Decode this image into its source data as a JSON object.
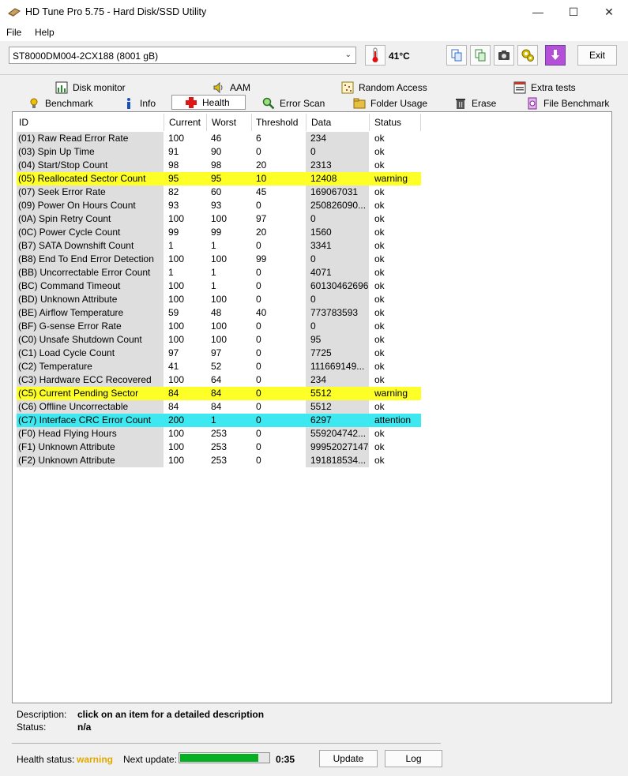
{
  "window": {
    "title": "HD Tune Pro 5.75 - Hard Disk/SSD Utility",
    "minimize_glyph": "—",
    "maximize_glyph": "☐",
    "close_glyph": "✕"
  },
  "menu": {
    "file": "File",
    "help": "Help"
  },
  "toolbar": {
    "drive": "ST8000DM004-2CX188 (8001 gB)",
    "temperature": "41°C",
    "exit_label": "Exit",
    "icons": [
      "copy-text-icon",
      "copy-info-icon",
      "screenshot-icon",
      "options-icon",
      "save-icon"
    ]
  },
  "tabs_row1": [
    {
      "label": "Disk monitor",
      "icon": "disk-monitor-icon"
    },
    {
      "label": "AAM",
      "icon": "aam-speaker-icon"
    },
    {
      "label": "Random Access",
      "icon": "random-access-icon"
    },
    {
      "label": "Extra tests",
      "icon": "extra-tests-icon"
    }
  ],
  "tabs_row2": [
    {
      "label": "Benchmark",
      "icon": "benchmark-icon"
    },
    {
      "label": "Info",
      "icon": "info-icon"
    },
    {
      "label": "Health",
      "icon": "health-cross-icon",
      "active": true
    },
    {
      "label": "Error Scan",
      "icon": "error-scan-icon"
    },
    {
      "label": "Folder Usage",
      "icon": "folder-icon"
    },
    {
      "label": "Erase",
      "icon": "erase-icon"
    },
    {
      "label": "File Benchmark",
      "icon": "file-benchmark-icon"
    }
  ],
  "table": {
    "headers": [
      "ID",
      "Current",
      "Worst",
      "Threshold",
      "Data",
      "Status"
    ],
    "rows": [
      [
        "(01) Raw Read Error Rate",
        "100",
        "46",
        "6",
        "234",
        "ok"
      ],
      [
        "(03) Spin Up Time",
        "91",
        "90",
        "0",
        "0",
        "ok"
      ],
      [
        "(04) Start/Stop Count",
        "98",
        "98",
        "20",
        "2313",
        "ok"
      ],
      [
        "(05) Reallocated Sector Count",
        "95",
        "95",
        "10",
        "12408",
        "warning"
      ],
      [
        "(07) Seek Error Rate",
        "82",
        "60",
        "45",
        "169067031",
        "ok"
      ],
      [
        "(09) Power On Hours Count",
        "93",
        "93",
        "0",
        "250826090...",
        "ok"
      ],
      [
        "(0A) Spin Retry Count",
        "100",
        "100",
        "97",
        "0",
        "ok"
      ],
      [
        "(0C) Power Cycle Count",
        "99",
        "99",
        "20",
        "1560",
        "ok"
      ],
      [
        "(B7) SATA Downshift Count",
        "1",
        "1",
        "0",
        "3341",
        "ok"
      ],
      [
        "(B8) End To End Error Detection",
        "100",
        "100",
        "99",
        "0",
        "ok"
      ],
      [
        "(BB) Uncorrectable Error Count",
        "1",
        "1",
        "0",
        "4071",
        "ok"
      ],
      [
        "(BC) Command Timeout",
        "100",
        "1",
        "0",
        "60130462696",
        "ok"
      ],
      [
        "(BD) Unknown Attribute",
        "100",
        "100",
        "0",
        "0",
        "ok"
      ],
      [
        "(BE) Airflow Temperature",
        "59",
        "48",
        "40",
        "773783593",
        "ok"
      ],
      [
        "(BF) G-sense Error Rate",
        "100",
        "100",
        "0",
        "0",
        "ok"
      ],
      [
        "(C0) Unsafe Shutdown Count",
        "100",
        "100",
        "0",
        "95",
        "ok"
      ],
      [
        "(C1) Load Cycle Count",
        "97",
        "97",
        "0",
        "7725",
        "ok"
      ],
      [
        "(C2) Temperature",
        "41",
        "52",
        "0",
        "111669149...",
        "ok"
      ],
      [
        "(C3) Hardware ECC Recovered",
        "100",
        "64",
        "0",
        "234",
        "ok"
      ],
      [
        "(C5) Current Pending Sector",
        "84",
        "84",
        "0",
        "5512",
        "warning"
      ],
      [
        "(C6) Offline Uncorrectable",
        "84",
        "84",
        "0",
        "5512",
        "ok"
      ],
      [
        "(C7) Interface CRC Error Count",
        "200",
        "1",
        "0",
        "6297",
        "attention"
      ],
      [
        "(F0) Head Flying Hours",
        "100",
        "253",
        "0",
        "559204742...",
        "ok"
      ],
      [
        "(F1) Unknown Attribute",
        "100",
        "253",
        "0",
        "99952027147",
        "ok"
      ],
      [
        "(F2) Unknown Attribute",
        "100",
        "253",
        "0",
        "191818534...",
        "ok"
      ]
    ]
  },
  "colors": {
    "warning": "#ffff28",
    "attention": "#3ee8f0",
    "health_warning_text": "#e0a800",
    "progress": "#06b025"
  },
  "footer": {
    "description_label": "Description:",
    "description_value": "click on an item for a detailed description",
    "status_label": "Status:",
    "status_value": "n/a",
    "health_label": "Health status:",
    "health_value": "warning",
    "next_update_label": "Next update:",
    "next_update_value": "0:35",
    "progress_fraction": 0.88,
    "update_button": "Update",
    "log_button": "Log"
  }
}
